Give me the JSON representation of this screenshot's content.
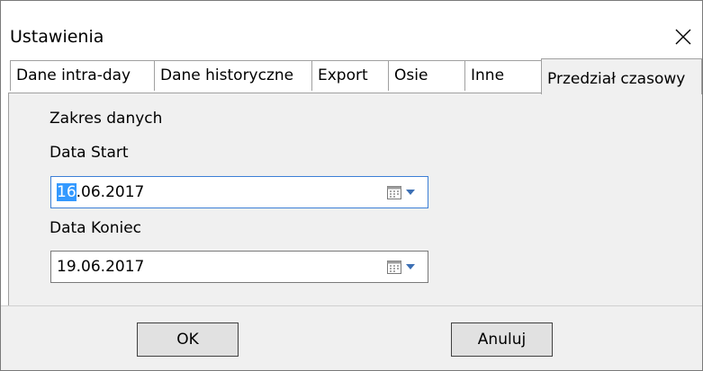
{
  "window": {
    "title": "Ustawienia"
  },
  "tabs": [
    {
      "label": "Dane intra-day",
      "active": false
    },
    {
      "label": "Dane historyczne",
      "active": false
    },
    {
      "label": "Export",
      "active": false
    },
    {
      "label": "Osie",
      "active": false
    },
    {
      "label": "Inne",
      "active": false
    },
    {
      "label": "Przedział czasowy",
      "active": true
    }
  ],
  "panel": {
    "group_label": "Zakres danych",
    "start": {
      "label": "Data Start",
      "selected_part": "16",
      "rest": ".06.2017",
      "icon": "calendar-dropdown-icon"
    },
    "end": {
      "label": "Data Koniec",
      "value": "19.06.2017",
      "icon": "calendar-dropdown-icon"
    }
  },
  "buttons": {
    "ok": "OK",
    "cancel": "Anuluj"
  },
  "colors": {
    "panel_bg": "#f0f0f0",
    "focus_border": "#3c7fd6",
    "selection": "#3399ff"
  }
}
